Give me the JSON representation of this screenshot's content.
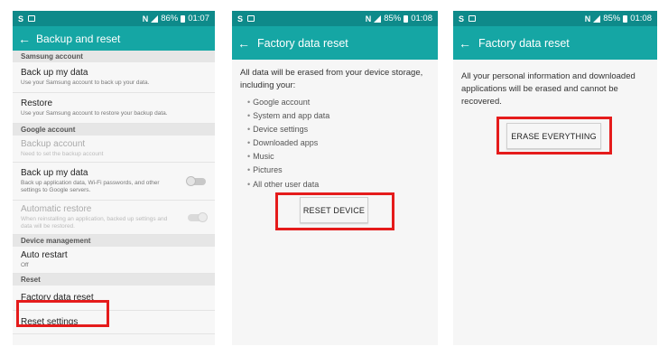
{
  "status_bars": [
    {
      "s": "S",
      "n": "N",
      "battery": "86%",
      "time": "01:07"
    },
    {
      "s": "S",
      "n": "N",
      "battery": "85%",
      "time": "01:08"
    },
    {
      "s": "S",
      "n": "N",
      "battery": "85%",
      "time": "01:08"
    }
  ],
  "screen1": {
    "title": "Backup and reset",
    "sections": {
      "samsung": "Samsung account",
      "google": "Google account",
      "device": "Device management",
      "reset": "Reset"
    },
    "items": {
      "backup_samsung": {
        "title": "Back up my data",
        "sub": "Use your Samsung account to back up your data."
      },
      "restore": {
        "title": "Restore",
        "sub": "Use your Samsung account to restore your backup data."
      },
      "backup_account": {
        "title": "Backup account",
        "sub": "Need to set the backup account"
      },
      "backup_google": {
        "title": "Back up my data",
        "sub": "Back up application data, Wi-Fi passwords, and other settings to Google servers."
      },
      "auto_restore": {
        "title": "Automatic restore",
        "sub": "When reinstalling an application, backed up settings and data will be restored."
      },
      "auto_restart": {
        "title": "Auto restart",
        "sub": "Off"
      },
      "factory_reset": {
        "title": "Factory data reset"
      },
      "reset_settings": {
        "title": "Reset settings"
      }
    },
    "toggles": {
      "backup_google": "off",
      "auto_restore": "on"
    }
  },
  "screen2": {
    "title": "Factory data reset",
    "intro": "All data will be erased from your device storage, including your:",
    "bullets": [
      "Google account",
      "System and app data",
      "Device settings",
      "Downloaded apps",
      "Music",
      "Pictures",
      "All other user data"
    ],
    "button": "RESET DEVICE"
  },
  "screen3": {
    "title": "Factory data reset",
    "message": "All your personal information and downloaded applications will be erased and cannot be recovered.",
    "button": "ERASE EVERYTHING"
  },
  "colors": {
    "status_bar": "#0e8a8a",
    "app_bar": "#15a6a4",
    "highlight": "#e51b1b"
  }
}
